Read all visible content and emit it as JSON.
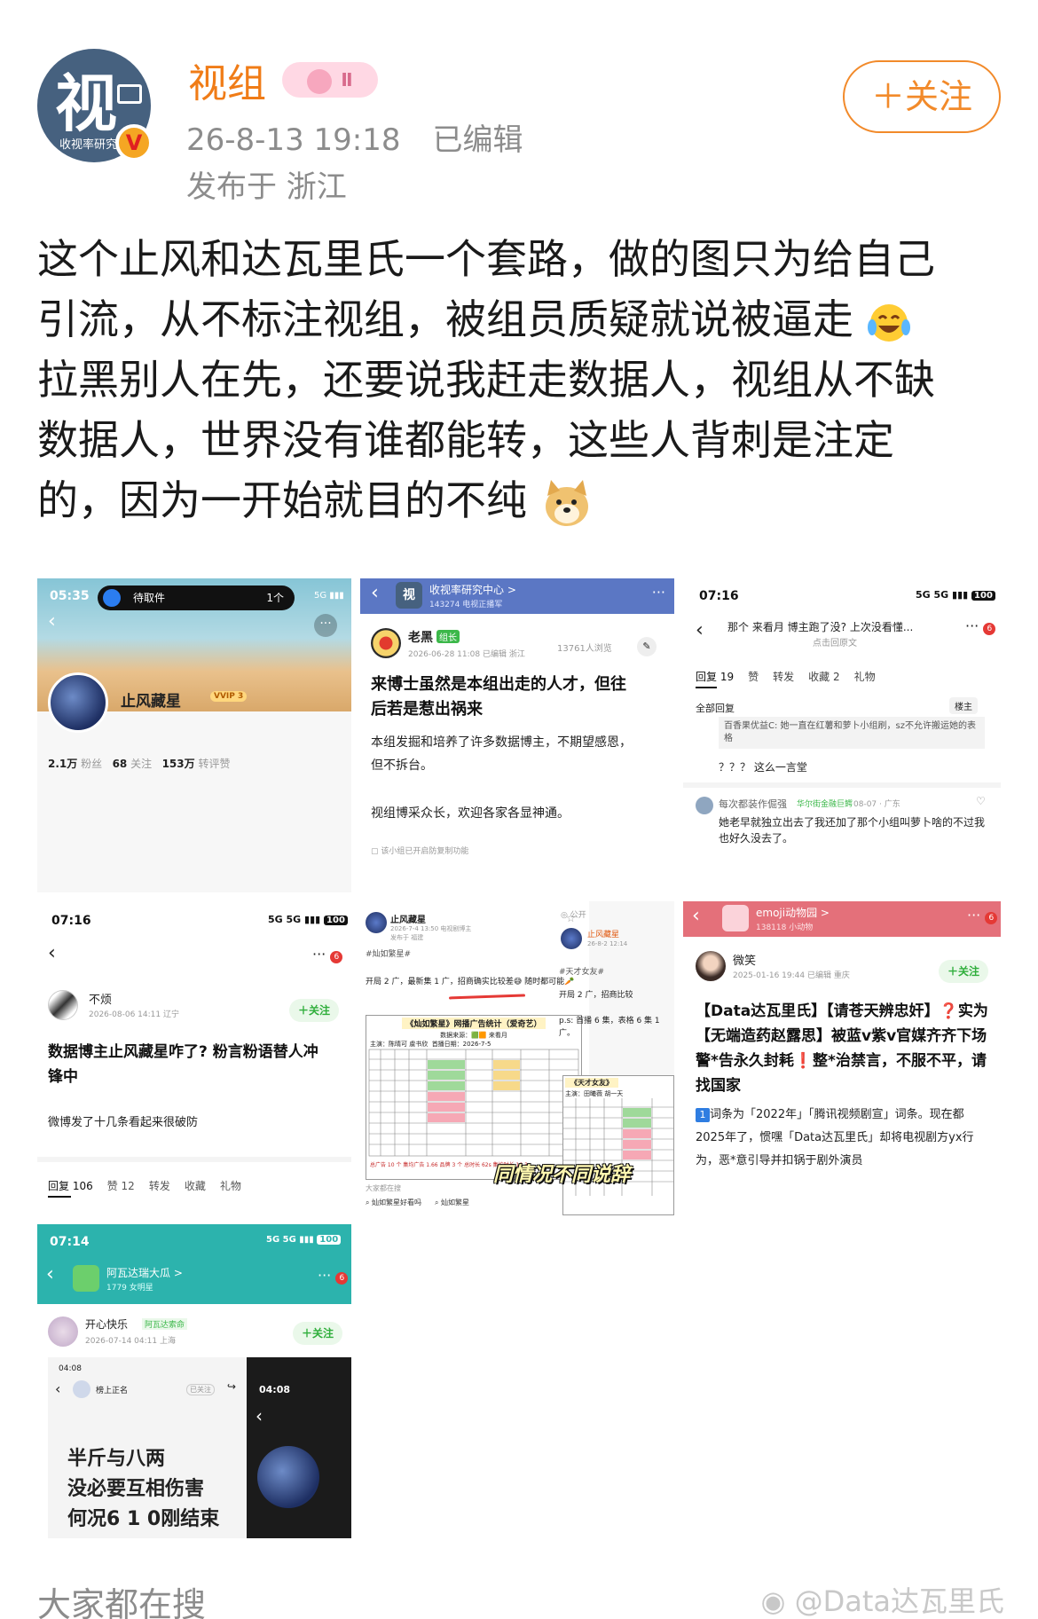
{
  "header": {
    "username": "视组",
    "level_badge": "Ⅱ",
    "avatar_glyph": "视",
    "avatar_caption": "收视率研究中",
    "verified_mark": "V",
    "timestamp": "26-8-13 19:18",
    "edited": "已编辑",
    "location": "发布于 浙江",
    "follow_label": "＋关注"
  },
  "post": {
    "lines": [
      "这个止风和达瓦里氏一个套路，做的图只为给自己",
      "引流，从不标注视组，被组员质疑就说被逼走",
      "拉黑别人在先，还要说我赶走数据人，视组从不缺",
      "数据人，世界没有谁都能转，这些人背刺是注定",
      "的，因为一开始就目的不纯"
    ]
  },
  "cell1": {
    "time": "05:35",
    "pill_label": "待取件",
    "pill_count": "1个",
    "status": "5G ▮▮▮",
    "username": "止风藏星",
    "vip": "VVIP 3",
    "stats": [
      {
        "num": "2.1万",
        "label": "粉丝"
      },
      {
        "num": "68",
        "label": "关注"
      },
      {
        "num": "153万",
        "label": "转评赞"
      }
    ]
  },
  "cell2": {
    "channel": "收视率研究中心 >",
    "channel_sub": "143274 电视正播军",
    "author": "老黑",
    "tag": "组长",
    "date": "2026-06-28 11:08  已编辑  浙江",
    "views": "13761人浏览",
    "headline": "来博士虽然是本组出走的人才，但往后若是惹出祸来",
    "p1": "本组发掘和培养了许多数据博主，不期望感恩，但不拆台。",
    "p2": "视组博采众长，欢迎各家各显神通。",
    "foot": "▢ 该小组已开启防复制功能"
  },
  "cell3": {
    "time": "07:16",
    "status": "5G 5G ▮▮▮",
    "battery": "100",
    "title": "那个 来看月 博主跑了没? 上次没看懂...",
    "subtitle": "点击回原文",
    "badge": "6",
    "tabs": [
      "回复 19",
      "赞",
      "转发",
      "收藏 2",
      "礼物"
    ],
    "all_replies": "全部回复",
    "louzhu": "楼主",
    "quote": "百香果优益C: 她一直在红薯和萝卜小组刷，sz不允许搬运她的表格",
    "reply1": "？？？ 这么一言堂",
    "user2": "每次都装作倔强",
    "user2_tag": "华尔街金融巨鳄",
    "user2_meta": "08-07 · 广东",
    "reply2": "她老早就独立出去了我还加了那个小组叫萝卜啥的不过我也好久没去了。"
  },
  "cell4": {
    "time": "07:16",
    "status": "5G 5G ▮▮▮",
    "battery": "100",
    "badge": "6",
    "user": "不烦",
    "date": "2026-08-06 14:11  辽宁",
    "follow": "＋关注",
    "headline": "数据博主止风藏星咋了? 粉言粉语替人冲锋中",
    "body": "微博发了十几条看起来很破防",
    "tabs": [
      "回复 106",
      "赞 12",
      "转发",
      "收藏",
      "礼物"
    ]
  },
  "cell5": {
    "author": "止风藏星",
    "meta": "2026-7-4 13:50  电视剧博主",
    "location": "发布于 福建",
    "hashtag": "#灿如繁星#",
    "text": "开局 2 广，最新集 1 广，招商确实比较差😅 随时都可能🥕",
    "table_title": "《灿如繁星》网播广告统计（爱奇艺）",
    "data_source": "数据来源：🟩🟧 来看月",
    "lead": "主演：陈晴可  虞书欣",
    "premiere": "首播日期：2026-7-5",
    "right_author": "止风藏星",
    "right_meta": "26-8-2 12:14",
    "right_hashtag": "#天才女友#",
    "right_text": "开局 2 广，招商比较",
    "right_ps": "p.s: 首播 6 集，表格 6 集 1 广。",
    "right_table_title": "《天才女友》",
    "right_lead": "主演：田曦薇 胡一天",
    "bottom_row": "总广告 10 个  集均广告 1.66  品牌 3 个  总时长 62s  集均时长 10.3s",
    "search_label": "大家都在搜",
    "search_item1": "灿如繁星好看吗",
    "search_item2": "灿如繁星",
    "caption": "同情况不同说辞",
    "public": "公开"
  },
  "cell6": {
    "channel": "emoji动物园 >",
    "channel_sub": "138118 小动物",
    "badge": "6",
    "user": "微笑",
    "date": "2025-01-16 19:44  已编辑  重庆",
    "follow": "＋关注",
    "headline": "【Data达瓦里氏】【请苍天辨忠奸】❓实为【无端造药赵露思】被蓝v紫v官媒齐齐下场警*告永久封耗❗整*治禁言，不服不平，请找国家",
    "number": "1",
    "body": "词条为「2022年」「腾讯视频剧宣」词条。现在都2025年了，惯嘿「Data达瓦里氏」却将电视剧方yx行为，恶*意引导并扣锅于剧外演员"
  },
  "cell7": {
    "time": "07:14",
    "status": "5G 5G ▮▮▮",
    "battery": "100",
    "channel": "阿瓦达瑞大瓜 >",
    "channel_sub": "1779 女明星",
    "badge": "6",
    "user": "开心快乐",
    "user_tag": "阿瓦达索命",
    "date": "2026-07-14 04:11  上海",
    "follow": "＋关注",
    "inner_time": "04:08",
    "inner_user": "榜上正名",
    "inner_follow": "已关注",
    "inner_time2": "04:08",
    "big1": "半斤与八两",
    "big2": "没必要互相伤害",
    "big3": "何况6 1 0刚结束"
  },
  "footer": {
    "search": "大家都在搜",
    "watermark": "@Data达瓦里氏"
  }
}
